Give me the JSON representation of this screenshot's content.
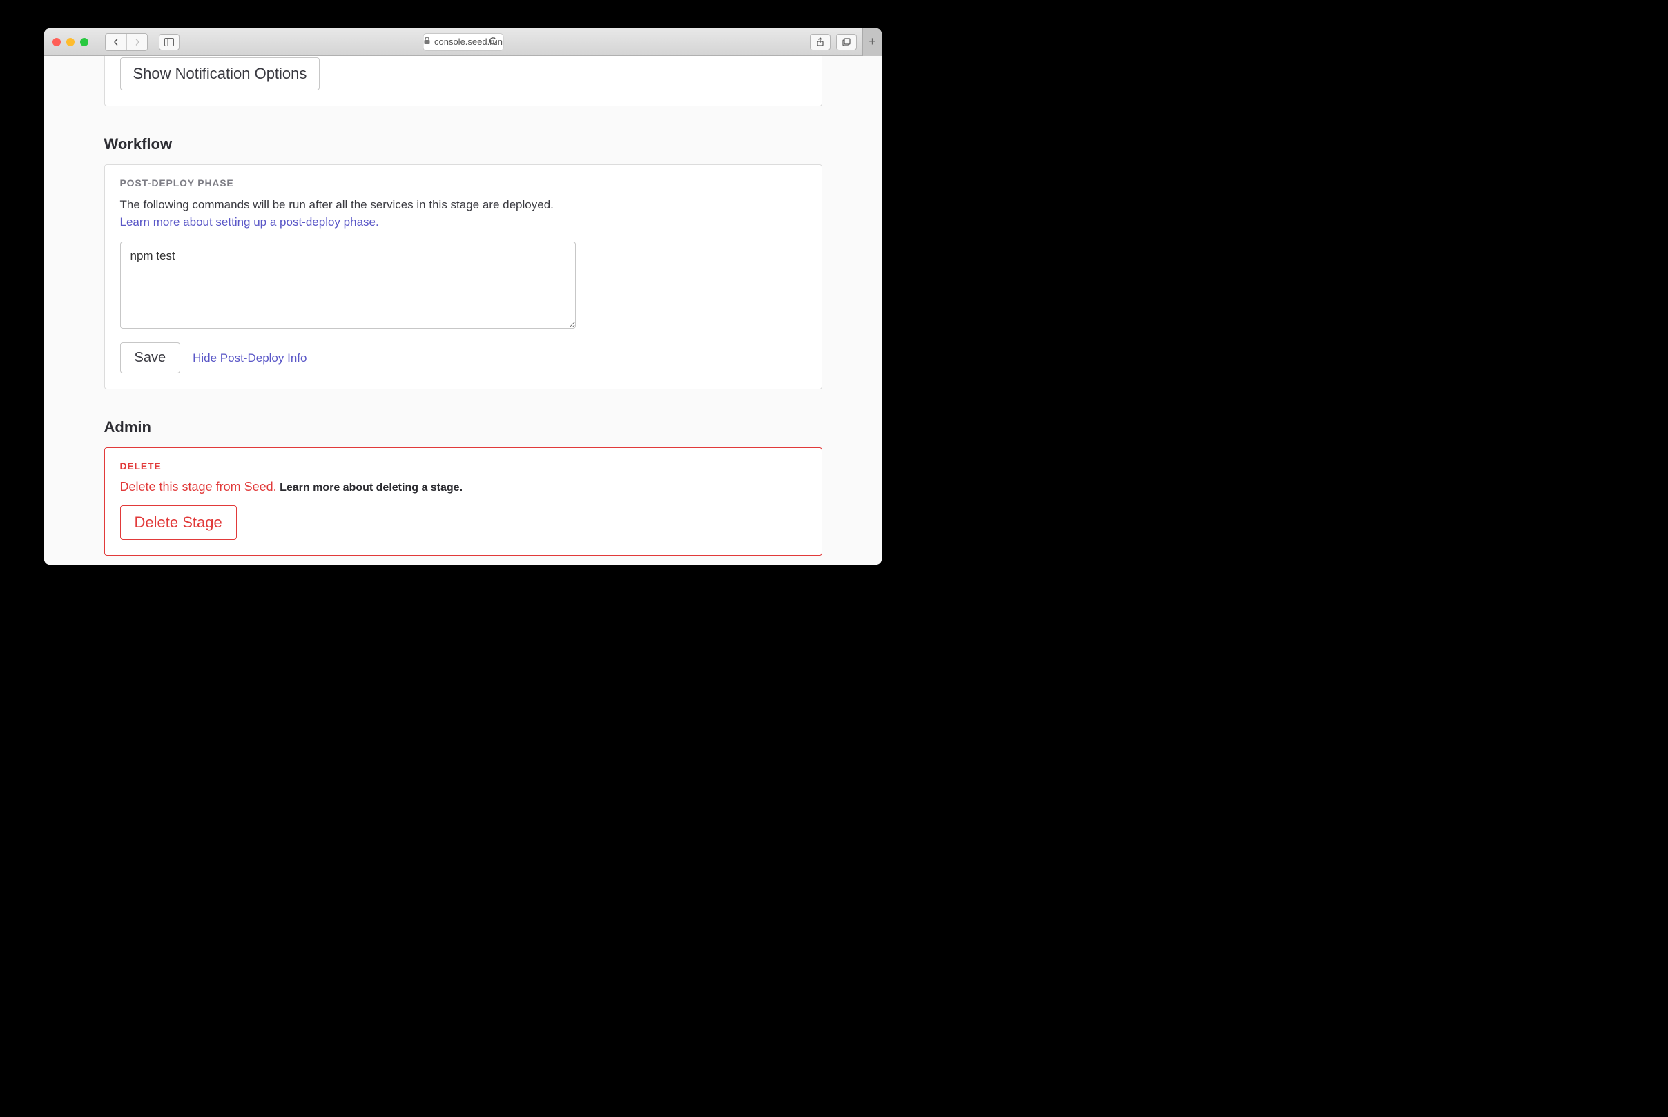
{
  "browser": {
    "url": "console.seed.run"
  },
  "notifications": {
    "show_options_label": "Show Notification Options"
  },
  "workflow": {
    "title": "Workflow",
    "phase_label": "POST-DEPLOY PHASE",
    "description": "The following commands will be run after all the services in this stage are deployed. ",
    "learn_more": "Learn more about setting up a post-deploy phase.",
    "commands_value": "npm test",
    "save_label": "Save",
    "hide_link": "Hide Post-Deploy Info"
  },
  "admin": {
    "title": "Admin",
    "delete_label": "DELETE",
    "delete_desc": "Delete this stage from Seed.",
    "learn_more": "Learn more about deleting a stage.",
    "delete_button": "Delete Stage"
  }
}
